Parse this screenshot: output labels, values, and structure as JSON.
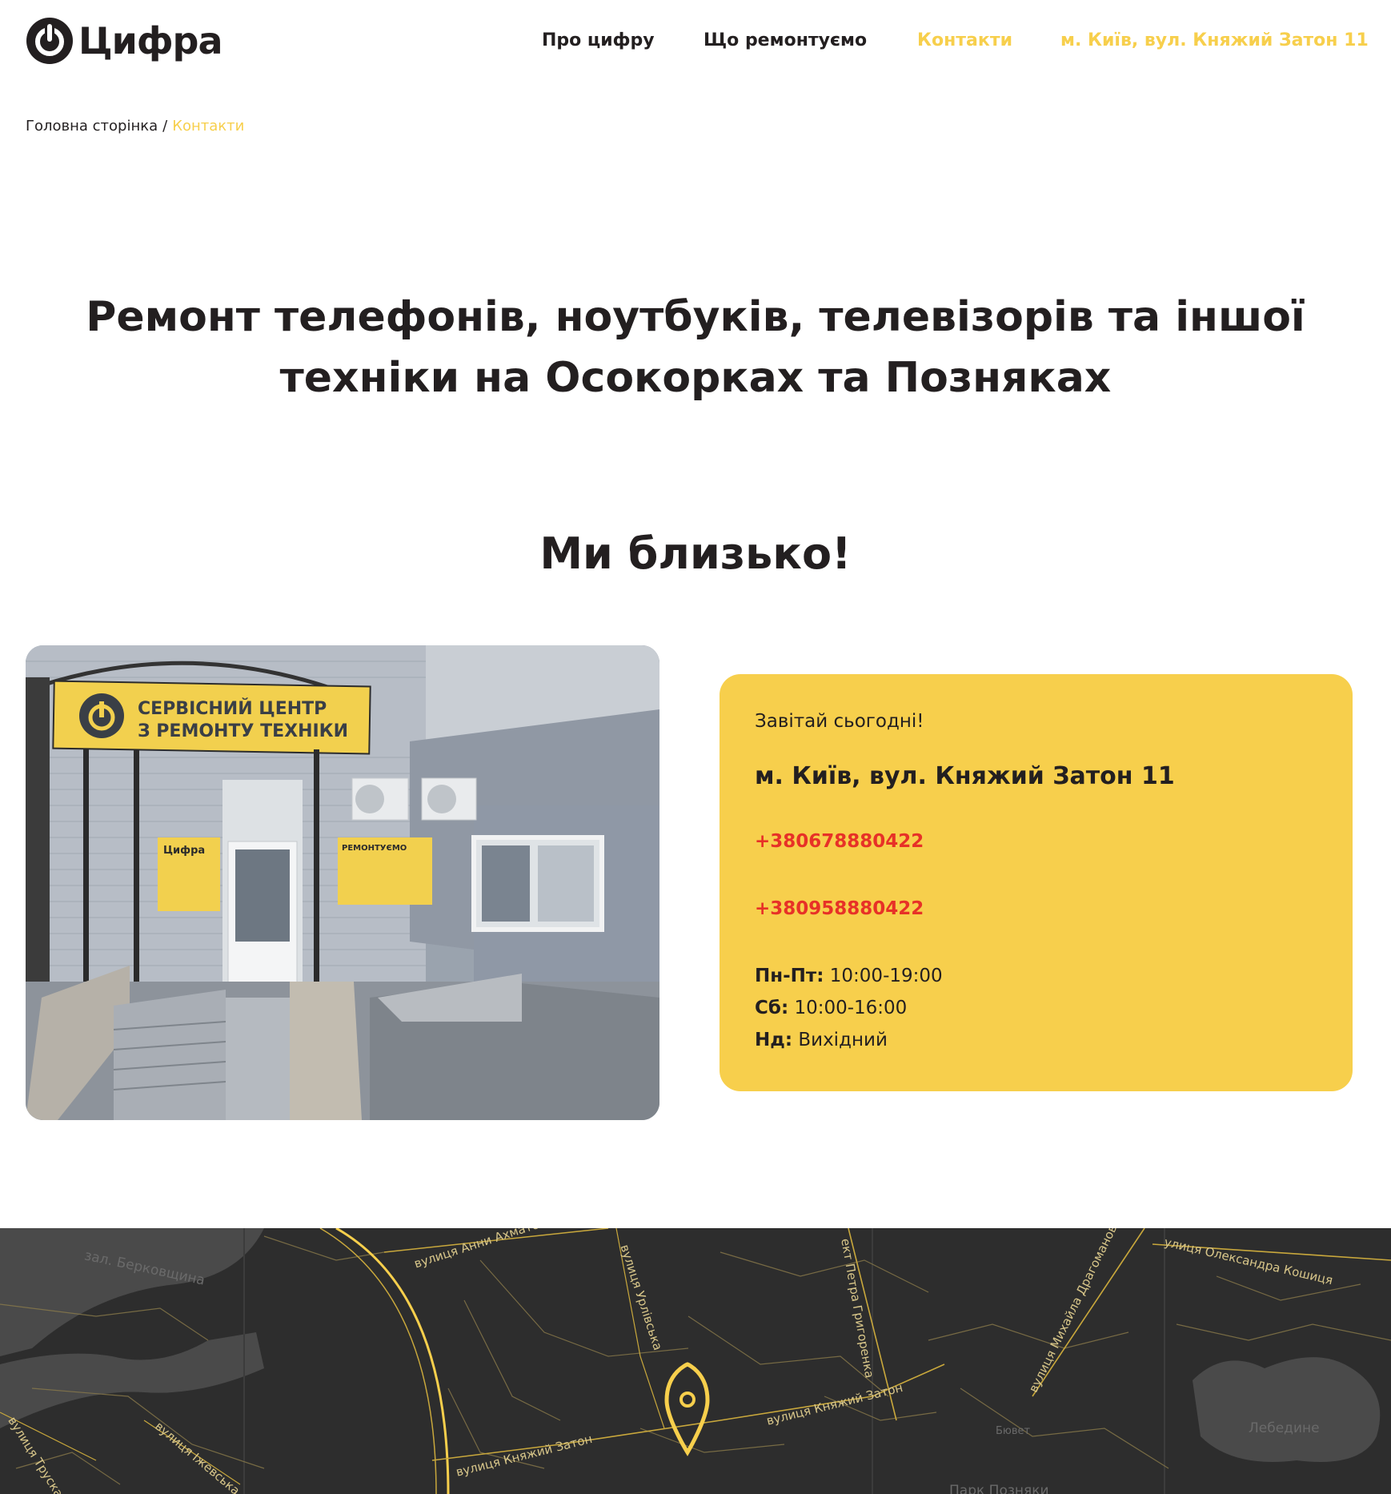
{
  "header": {
    "logo_text": "Цифра",
    "nav": [
      {
        "label": "Про цифру"
      },
      {
        "label": "Що ремонтуємо"
      },
      {
        "label": "Контакти"
      },
      {
        "label": "м. Київ, вул. Княжий Затон 11"
      }
    ]
  },
  "breadcrumb": {
    "home": "Головна сторінка",
    "separator": "/",
    "current": "Контакти"
  },
  "hero": {
    "title_line1": "Ремонт телефонів, ноутбуків, телевізорів та іншої",
    "title_line2": "техніки на Осокорках та Позняках"
  },
  "section": {
    "title": "Ми близько!"
  },
  "photo": {
    "sign_line1": "СЕРВІСНИЙ ЦЕНТР",
    "sign_line2": "З РЕМОНТУ ТЕХНІКИ",
    "poster_left": "Цифра",
    "poster_right": "РЕМОНТУЄМО"
  },
  "contact_card": {
    "invite": "Завітай сьогодні!",
    "address": "м. Київ, вул. Княжий Затон 11",
    "phone1": "+380678880422",
    "phone2": "+380958880422",
    "hours": [
      {
        "day": "Пн-Пт:",
        "time": "10:00-19:00"
      },
      {
        "day": "Сб:",
        "time": "10:00-16:00"
      },
      {
        "day": "Нд:",
        "time": "Вихідний"
      }
    ]
  },
  "map": {
    "streets": [
      "зал. Берковщина",
      "вулиця Анни Ахматової",
      "вулиця Урлівська",
      "ект Петра Григоренка",
      "вулиця Михайла Драгоманова",
      "улиця Олександра Кошиця",
      "вулиця Княжий Затон",
      "вулиця Княжий Затон",
      "вулиця Трускавецька",
      "вулиця Іжевська",
      "Лебедине",
      "Бювет",
      "Парк Позняки"
    ]
  },
  "colors": {
    "accent": "#f7cf4c",
    "text": "#231f20",
    "phone": "#e73127",
    "map_bg": "#2d2d2d"
  }
}
